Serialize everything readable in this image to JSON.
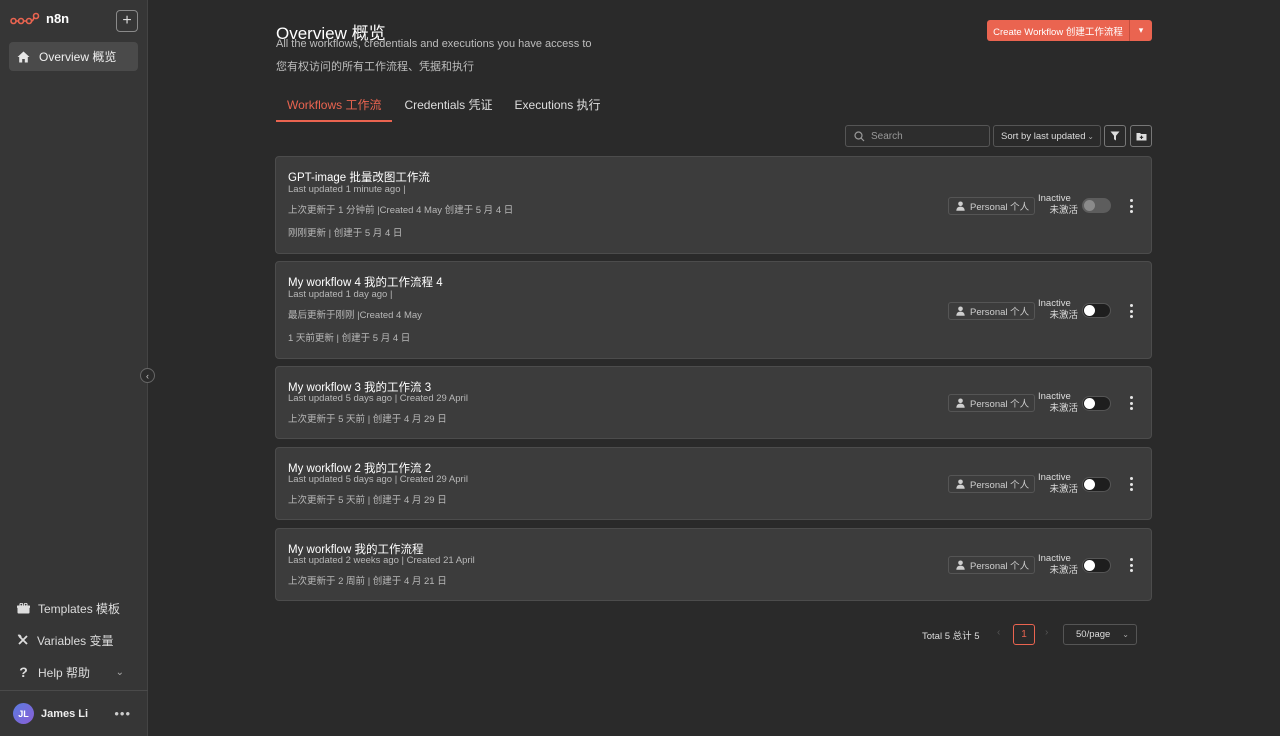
{
  "app": {
    "name": "n8n",
    "accent": "#ea6450"
  },
  "sidebar": {
    "add_label": "+",
    "overview_label": "Overview  概览",
    "bottom_items": [
      {
        "label": "Templates  模板",
        "icon": "gift-icon"
      },
      {
        "label": "Variables  变量",
        "icon": "variable-icon"
      },
      {
        "label": "Help  帮助",
        "icon": "help-icon"
      }
    ],
    "user": {
      "initials": "JL",
      "name": "James Li",
      "menu": "•••"
    },
    "collapse": "‹"
  },
  "header": {
    "title": "Overview  概览",
    "subtitle_en": "All the workflows, credentials and executions you have access to",
    "subtitle_zh": "您有权访问的所有工作流程、凭据和执行",
    "create_label": "Create Workflow  创建工作流程"
  },
  "tabs": [
    {
      "label": "Workflows  工作流",
      "active": true
    },
    {
      "label": "Credentials  凭证",
      "active": false
    },
    {
      "label": "Executions  执行",
      "active": false
    }
  ],
  "toolbar": {
    "search_placeholder": "Search",
    "sort_label": "Sort by last updated"
  },
  "workflows": [
    {
      "title": "GPT-image 批量改图工作流",
      "lines": [
        "Last updated 1 minute ago |",
        "上次更新于 1 分钟前 |Created 4 May  创建于 5 月 4 日",
        "刚刚更新 | 创建于 5 月 4 日"
      ],
      "owner": "Personal  个人",
      "status_en": "Inactive",
      "status_zh": "未激活"
    },
    {
      "title": "My workflow 4   我的工作流程 4",
      "lines": [
        "Last updated 1 day ago |",
        "最后更新于刚刚 |Created 4 May",
        "1 天前更新 | 创建于 5 月 4 日"
      ],
      "owner": "Personal  个人",
      "status_en": "Inactive",
      "status_zh": "未激活"
    },
    {
      "title": "My workflow 3   我的工作流 3",
      "lines": [
        "Last updated 5 days ago | Created 29 April",
        "上次更新于 5 天前 | 创建于 4 月 29 日"
      ],
      "owner": "Personal  个人",
      "status_en": "Inactive",
      "status_zh": "未激活"
    },
    {
      "title": "My workflow 2   我的工作流 2",
      "lines": [
        "Last updated 5 days ago | Created 29 April",
        "上次更新于 5 天前 | 创建于 4 月 29 日"
      ],
      "owner": "Personal  个人",
      "status_en": "Inactive",
      "status_zh": "未激活"
    },
    {
      "title": "My workflow   我的工作流程",
      "lines": [
        "Last updated 2 weeks ago | Created 21 April",
        "上次更新于 2 周前 | 创建于 4 月 21 日"
      ],
      "owner": "Personal  个人",
      "status_en": "Inactive",
      "status_zh": "未激活"
    }
  ],
  "pagination": {
    "total": "Total 5  总计 5",
    "prev": "‹",
    "current": "1",
    "next": "›",
    "per_page": "50/page"
  }
}
